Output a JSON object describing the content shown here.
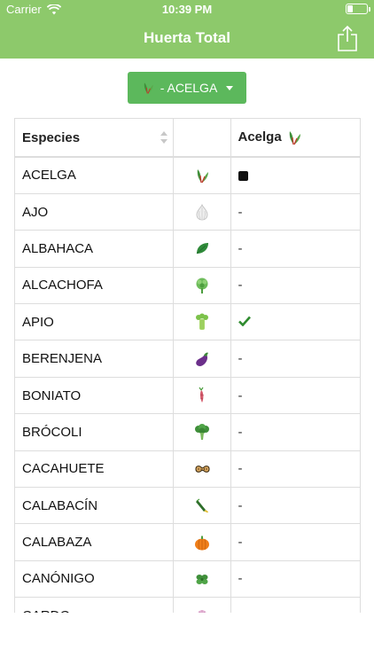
{
  "status_bar": {
    "carrier": "Carrier",
    "time": "10:39 PM",
    "battery_level": 0.3
  },
  "nav": {
    "title": "Huerta Total",
    "share_icon": "share-icon"
  },
  "selector": {
    "label": "- ACELGA",
    "icon": "chard-icon"
  },
  "table": {
    "headers": {
      "species": "Especies",
      "compare": "Acelga"
    },
    "rows": [
      {
        "name": "ACELGA",
        "icon": "chard-icon",
        "value": "",
        "status": "self"
      },
      {
        "name": "AJO",
        "icon": "garlic-icon",
        "value": "-",
        "status": "neutral"
      },
      {
        "name": "ALBAHACA",
        "icon": "basil-icon",
        "value": "-",
        "status": "neutral"
      },
      {
        "name": "ALCACHOFA",
        "icon": "artichoke-icon",
        "value": "-",
        "status": "neutral"
      },
      {
        "name": "APIO",
        "icon": "celery-icon",
        "value": "",
        "status": "good"
      },
      {
        "name": "BERENJENA",
        "icon": "eggplant-icon",
        "value": "-",
        "status": "neutral"
      },
      {
        "name": "BONIATO",
        "icon": "sweet-potato-icon",
        "value": "-",
        "status": "neutral"
      },
      {
        "name": "BRÓCOLI",
        "icon": "broccoli-icon",
        "value": "-",
        "status": "neutral"
      },
      {
        "name": "CACAHUETE",
        "icon": "peanut-icon",
        "value": "-",
        "status": "neutral"
      },
      {
        "name": "CALABACÍN",
        "icon": "zucchini-icon",
        "value": "-",
        "status": "neutral"
      },
      {
        "name": "CALABAZA",
        "icon": "pumpkin-icon",
        "value": "-",
        "status": "neutral"
      },
      {
        "name": "CANÓNIGO",
        "icon": "lambs-lettuce-icon",
        "value": "-",
        "status": "neutral"
      },
      {
        "name": "CARDO",
        "icon": "thistle-icon",
        "value": "-",
        "status": "neutral"
      }
    ]
  },
  "colors": {
    "header_green": "#8dc96b",
    "button_green": "#5cb85c",
    "check_green": "#2e8b2e"
  }
}
